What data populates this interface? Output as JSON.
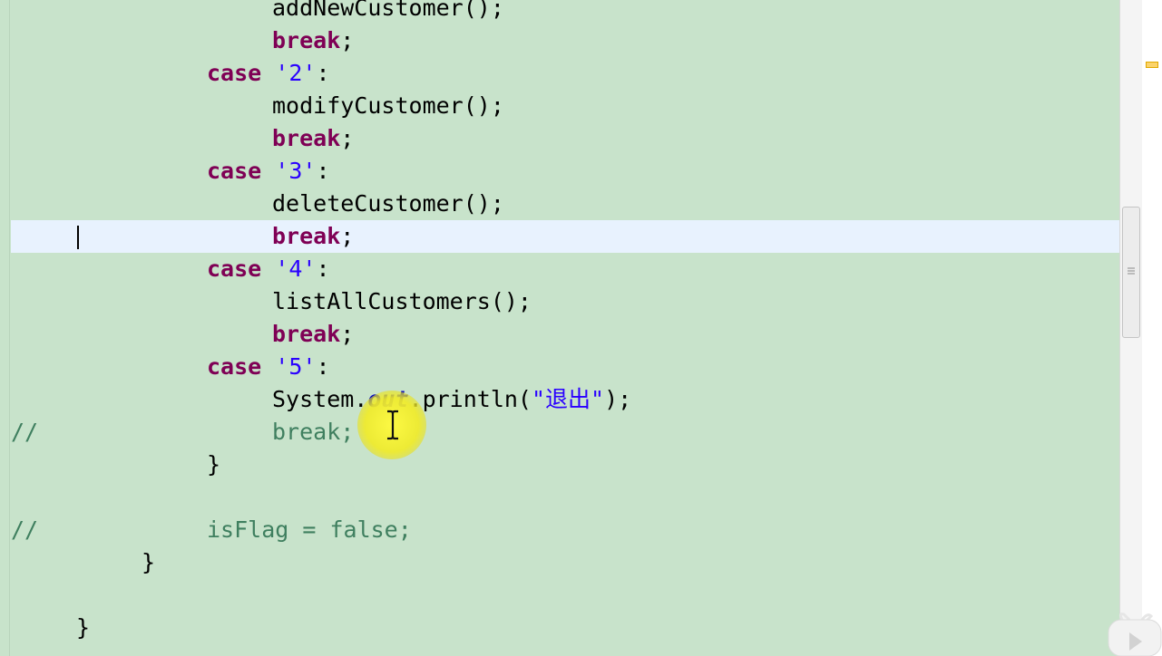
{
  "editor": {
    "lines": [
      {
        "indent": 4,
        "comment_marker": "",
        "tokens": [
          {
            "t": "addNewCustomer();",
            "c": "pl"
          }
        ]
      },
      {
        "indent": 4,
        "comment_marker": "",
        "tokens": [
          {
            "t": "break",
            "c": "kw"
          },
          {
            "t": ";",
            "c": "pl"
          }
        ]
      },
      {
        "indent": 3,
        "comment_marker": "",
        "tokens": [
          {
            "t": "case",
            "c": "kw"
          },
          {
            "t": " ",
            "c": "pl"
          },
          {
            "t": "'2'",
            "c": "str"
          },
          {
            "t": ":",
            "c": "pl"
          }
        ]
      },
      {
        "indent": 4,
        "comment_marker": "",
        "tokens": [
          {
            "t": "modifyCustomer();",
            "c": "pl"
          }
        ]
      },
      {
        "indent": 4,
        "comment_marker": "",
        "tokens": [
          {
            "t": "break",
            "c": "kw"
          },
          {
            "t": ";",
            "c": "pl"
          }
        ]
      },
      {
        "indent": 3,
        "comment_marker": "",
        "tokens": [
          {
            "t": "case",
            "c": "kw"
          },
          {
            "t": " ",
            "c": "pl"
          },
          {
            "t": "'3'",
            "c": "str"
          },
          {
            "t": ":",
            "c": "pl"
          }
        ]
      },
      {
        "indent": 4,
        "comment_marker": "",
        "tokens": [
          {
            "t": "deleteCustomer();",
            "c": "pl"
          }
        ]
      },
      {
        "indent": 4,
        "comment_marker": "",
        "current": true,
        "tokens": [
          {
            "t": "break",
            "c": "kw"
          },
          {
            "t": ";",
            "c": "pl"
          }
        ]
      },
      {
        "indent": 3,
        "comment_marker": "",
        "tokens": [
          {
            "t": "case",
            "c": "kw"
          },
          {
            "t": " ",
            "c": "pl"
          },
          {
            "t": "'4'",
            "c": "str"
          },
          {
            "t": ":",
            "c": "pl"
          }
        ]
      },
      {
        "indent": 4,
        "comment_marker": "",
        "tokens": [
          {
            "t": "listAllCustomers();",
            "c": "pl"
          }
        ]
      },
      {
        "indent": 4,
        "comment_marker": "",
        "tokens": [
          {
            "t": "break",
            "c": "kw"
          },
          {
            "t": ";",
            "c": "pl"
          }
        ]
      },
      {
        "indent": 3,
        "comment_marker": "",
        "tokens": [
          {
            "t": "case",
            "c": "kw"
          },
          {
            "t": " ",
            "c": "pl"
          },
          {
            "t": "'5'",
            "c": "str"
          },
          {
            "t": ":",
            "c": "pl"
          }
        ]
      },
      {
        "indent": 4,
        "comment_marker": "",
        "tokens": [
          {
            "t": "System.",
            "c": "pl"
          },
          {
            "t": "out",
            "c": "field"
          },
          {
            "t": ".println(",
            "c": "pl"
          },
          {
            "t": "\"退出\"",
            "c": "str"
          },
          {
            "t": ");",
            "c": "pl"
          }
        ]
      },
      {
        "indent": 4,
        "comment_marker": "//",
        "tokens": [
          {
            "t": "break;",
            "c": "comment"
          }
        ]
      },
      {
        "indent": 3,
        "comment_marker": "",
        "tokens": [
          {
            "t": "}",
            "c": "pl"
          }
        ]
      },
      {
        "indent": 0,
        "comment_marker": "",
        "tokens": []
      },
      {
        "indent": 3,
        "comment_marker": "//",
        "tokens": [
          {
            "t": "isFlag = false;",
            "c": "comment"
          }
        ]
      },
      {
        "indent": 2,
        "comment_marker": "",
        "tokens": [
          {
            "t": "}",
            "c": "pl"
          }
        ]
      },
      {
        "indent": 0,
        "comment_marker": "",
        "tokens": []
      },
      {
        "indent": 1,
        "comment_marker": "",
        "tokens": [
          {
            "t": "}",
            "c": "pl"
          }
        ]
      }
    ]
  },
  "colors": {
    "background": "#c8e3cb",
    "current_line": "#e8f2fe",
    "keyword": "#7f0055",
    "string": "#2a00ff",
    "static_field": "#0000c0",
    "comment": "#3f7f5f",
    "plain": "#000000",
    "cursor_highlight": "#f5ef2e",
    "warning_marker": "#fbd36a"
  },
  "icons": {
    "text_cursor": "ibeam-cursor-icon",
    "scrollbar_grip": "grip-icon",
    "play_overlay": "play-icon",
    "warning_marker": "warning-marker-icon"
  }
}
